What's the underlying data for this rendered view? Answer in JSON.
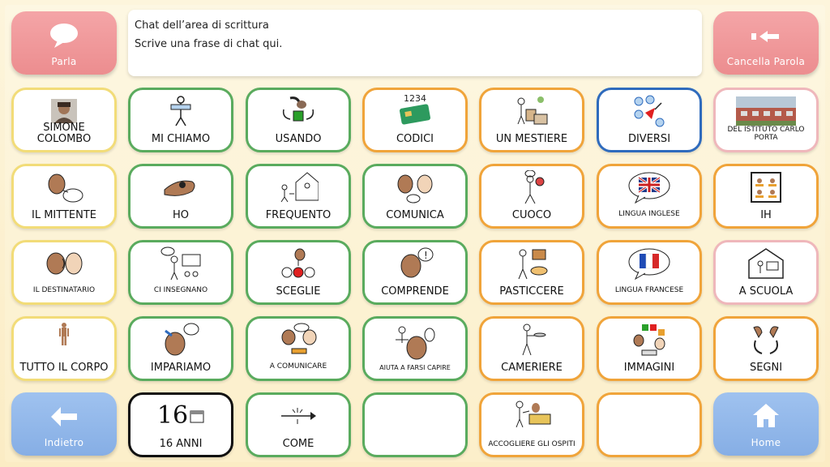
{
  "top": {
    "speak_label": "Parla",
    "clear_label": "Cancella Parola",
    "chat_line1": "Chat dell’area di scrittura",
    "chat_line2": "Scrive una frase di chat qui."
  },
  "nav": {
    "back_label": "Indietro",
    "home_label": "Home"
  },
  "colors": {
    "green": "#5aab5e",
    "orange": "#f0a43a",
    "yellow": "#f2dc78",
    "blue": "#2f6bbd",
    "pink_border": "#efb7bb",
    "black": "#111111",
    "pink_button": "#ec8d8f",
    "blue_button": "#86aee5"
  },
  "grid": {
    "r1": [
      {
        "label": "SIMONE COLOMBO",
        "icon": "person-photo"
      },
      {
        "label": "MI CHIAMO",
        "icon": "name-tag-icon"
      },
      {
        "label": "USANDO",
        "icon": "hand-use-icon"
      },
      {
        "label": "CODICI",
        "icon": "code-card-icon",
        "icon_text": "1234"
      },
      {
        "label": "UN MESTIERE",
        "icon": "job-icon"
      },
      {
        "label": "DIVERSI",
        "icon": "different-icon"
      },
      {
        "label": "DEL ISTITUTO CARLO PORTA",
        "icon": "school-photo"
      }
    ],
    "r2": [
      {
        "label": "IL MITTENTE",
        "icon": "sender-icon"
      },
      {
        "label": "HO",
        "icon": "have-hand-icon"
      },
      {
        "label": "FREQUENTO",
        "icon": "attend-icon"
      },
      {
        "label": "COMUNICA",
        "icon": "communicate-icon"
      },
      {
        "label": "CUOCO",
        "icon": "cook-icon"
      },
      {
        "label": "LINGUA INGLESE",
        "icon": "uk-flag-icon"
      },
      {
        "label": "IH",
        "icon": "ih-icon"
      }
    ],
    "r3": [
      {
        "label": "IL DESTINATARIO",
        "icon": "receiver-icon"
      },
      {
        "label": "CI INSEGNANO",
        "icon": "teach-icon"
      },
      {
        "label": "SCEGLIE",
        "icon": "choose-icon"
      },
      {
        "label": "COMPRENDE",
        "icon": "understand-icon"
      },
      {
        "label": "PASTICCERE",
        "icon": "baker-icon"
      },
      {
        "label": "LINGUA FRANCESE",
        "icon": "fr-flag-icon"
      },
      {
        "label": "A SCUOLA",
        "icon": "school-icon"
      }
    ],
    "r4": [
      {
        "label": "TUTTO IL CORPO",
        "icon": "body-icon"
      },
      {
        "label": "IMPARIAMO",
        "icon": "learn-icon"
      },
      {
        "label": "A COMUNICARE",
        "icon": "to-communicate-icon"
      },
      {
        "label": "AIUTA A FARSI CAPIRE",
        "icon": "help-understand-icon"
      },
      {
        "label": "CAMERIERE",
        "icon": "waiter-icon"
      },
      {
        "label": "IMMAGINI",
        "icon": "images-icon"
      },
      {
        "label": "SEGNI",
        "icon": "signs-icon"
      }
    ],
    "r5": [
      {
        "label": "16 ANNI",
        "icon": "age-icon",
        "icon_text": "16"
      },
      {
        "label": "COME",
        "icon": "how-icon"
      },
      {
        "label": "",
        "icon": ""
      },
      {
        "label": "ACCOGLIERE GLI OSPITI",
        "icon": "welcome-guests-icon"
      },
      {
        "label": "",
        "icon": ""
      }
    ]
  }
}
